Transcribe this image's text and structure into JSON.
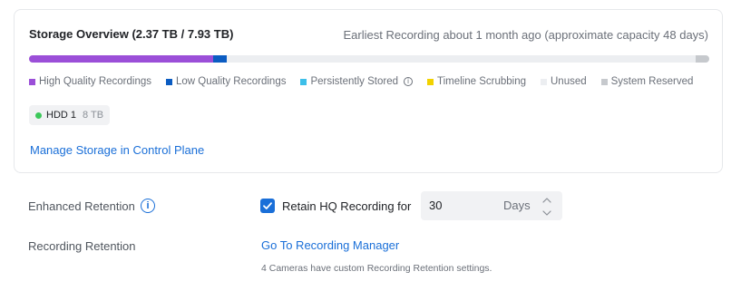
{
  "storage": {
    "title": "Storage Overview (2.37 TB / 7.93 TB)",
    "earliest": "Earliest Recording about 1 month ago (approximate capacity 48 days)",
    "usage": {
      "high_quality_fraction": 0.27,
      "low_quality_fraction": 0.02,
      "system_reserved_fraction": 0.02
    },
    "legend": [
      {
        "label": "High Quality Recordings",
        "color": "#9b4fd8",
        "icon": null
      },
      {
        "label": "Low Quality Recordings",
        "color": "#0b5cc2",
        "icon": null
      },
      {
        "label": "Persistently Stored",
        "color": "#3dbfe9",
        "icon": "info-icon"
      },
      {
        "label": "Timeline Scrubbing",
        "color": "#f2d200",
        "icon": null
      },
      {
        "label": "Unused",
        "color": "#eceef1",
        "icon": null
      },
      {
        "label": "System Reserved",
        "color": "#c6c9cd",
        "icon": null
      }
    ],
    "drive": {
      "name": "HDD 1",
      "size": "8 TB",
      "status_color": "#3cc85a"
    },
    "manage_link": "Manage Storage in Control Plane"
  },
  "enhanced_retention": {
    "label": "Enhanced Retention",
    "checked": true,
    "checkbox_label": "Retain HQ Recording for",
    "value": "30",
    "unit": "Days"
  },
  "recording_retention": {
    "label": "Recording Retention",
    "link": "Go To Recording Manager",
    "note": "4 Cameras have custom Recording Retention settings."
  }
}
